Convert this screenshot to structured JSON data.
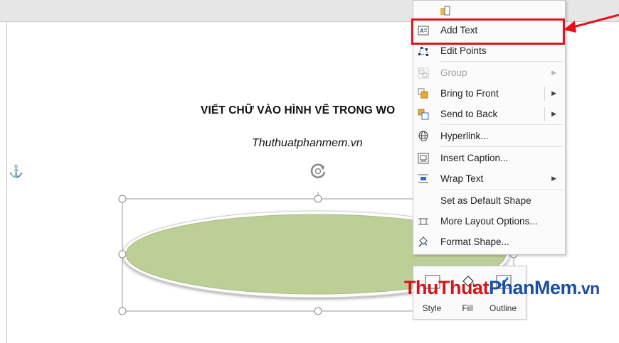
{
  "document": {
    "title": "VIẾT CHỮ VÀO HÌNH VẼ TRONG WO",
    "subtitle": "Thuthuatphanmem.vn"
  },
  "context_menu": {
    "items": [
      {
        "id": "add-text",
        "label": "Add Text",
        "icon": "add-text-icon",
        "submenu": false,
        "disabled": false
      },
      {
        "id": "edit-points",
        "label": "Edit Points",
        "icon": "edit-points-icon",
        "submenu": false,
        "disabled": false
      },
      {
        "id": "group",
        "label": "Group",
        "icon": "group-icon",
        "submenu": true,
        "disabled": true
      },
      {
        "id": "bring-to-front",
        "label": "Bring to Front",
        "icon": "bring-to-front-icon",
        "submenu": true,
        "disabled": false
      },
      {
        "id": "send-to-back",
        "label": "Send to Back",
        "icon": "send-to-back-icon",
        "submenu": true,
        "disabled": false
      },
      {
        "id": "hyperlink",
        "label": "Hyperlink...",
        "icon": "hyperlink-icon",
        "submenu": false,
        "disabled": false
      },
      {
        "id": "insert-caption",
        "label": "Insert Caption...",
        "icon": "insert-caption-icon",
        "submenu": false,
        "disabled": false
      },
      {
        "id": "wrap-text",
        "label": "Wrap Text",
        "icon": "wrap-text-icon",
        "submenu": true,
        "disabled": false
      },
      {
        "id": "set-default-shape",
        "label": "Set as Default Shape",
        "icon": "",
        "submenu": false,
        "disabled": false
      },
      {
        "id": "more-layout-options",
        "label": "More Layout Options...",
        "icon": "layout-options-icon",
        "submenu": false,
        "disabled": false
      },
      {
        "id": "format-shape",
        "label": "Format Shape...",
        "icon": "format-shape-icon",
        "submenu": false,
        "disabled": false
      }
    ]
  },
  "mini_toolbar": {
    "style_label": "Style",
    "fill_label": "Fill",
    "outline_label": "Outline"
  },
  "watermark": {
    "part1": "ThuThuat",
    "part2": "PhanMem",
    "part3": ".vn"
  },
  "colors": {
    "shape_fill": "#bccf97",
    "highlight": "#e8101b",
    "watermark_red": "#d5141b",
    "watermark_blue": "#1a4fa3"
  }
}
